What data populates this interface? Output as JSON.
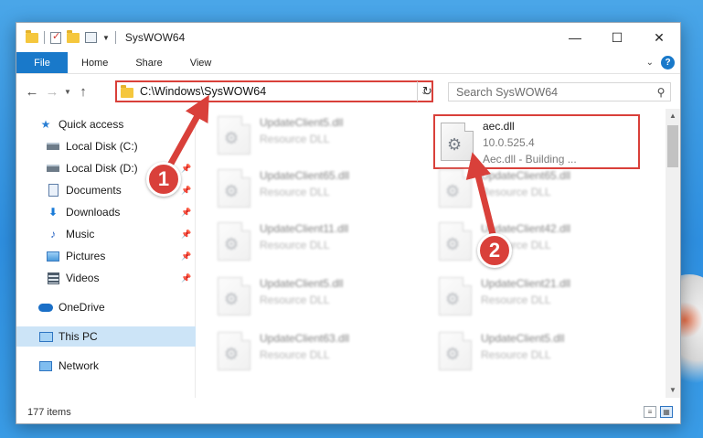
{
  "window": {
    "title": "SysWOW64",
    "controls": {
      "minimize": "—",
      "maximize": "☐",
      "close": "✕"
    }
  },
  "ribbon": {
    "tabs": [
      "File",
      "Home",
      "Share",
      "View"
    ],
    "help": "?"
  },
  "address": {
    "path": "C:\\Windows\\SysWOW64",
    "refresh": "↻"
  },
  "search": {
    "placeholder": "Search SysWOW64"
  },
  "sidebar": {
    "items": [
      {
        "label": "Quick access",
        "icon": "star-icon"
      },
      {
        "label": "Local Disk (C:)",
        "icon": "drive-icon"
      },
      {
        "label": "Local Disk (D:)",
        "icon": "drive-icon"
      },
      {
        "label": "Documents",
        "icon": "documents-icon"
      },
      {
        "label": "Downloads",
        "icon": "download-icon"
      },
      {
        "label": "Music",
        "icon": "music-icon"
      },
      {
        "label": "Pictures",
        "icon": "pictures-icon"
      },
      {
        "label": "Videos",
        "icon": "videos-icon"
      },
      {
        "label": "OneDrive",
        "icon": "cloud-icon"
      },
      {
        "label": "This PC",
        "icon": "computer-icon"
      },
      {
        "label": "Network",
        "icon": "network-icon"
      }
    ]
  },
  "files": {
    "col1": [
      {
        "name": "UpdateClient5.dll",
        "type": "Resource DLL"
      },
      {
        "name": "UpdateClient65.dll",
        "type": "Resource DLL"
      },
      {
        "name": "UpdateClient11.dll",
        "type": "Resource DLL"
      },
      {
        "name": "UpdateClient5.dll",
        "type": "Resource DLL"
      },
      {
        "name": "UpdateClient63.dll",
        "type": "Resource DLL"
      }
    ],
    "selected": {
      "name": "aec.dll",
      "version": "10.0.525.4",
      "description": "Aec.dll - Building ..."
    },
    "col2": [
      {
        "name": "UpdateClient65.dll",
        "type": "Resource DLL"
      },
      {
        "name": "UpdateClient42.dll",
        "type": "Resource DLL"
      },
      {
        "name": "UpdateClient21.dll",
        "type": "Resource DLL"
      },
      {
        "name": "UpdateClient5.dll",
        "type": "Resource DLL"
      }
    ]
  },
  "status": {
    "item_count": "177 items"
  },
  "annotations": {
    "step1": "1",
    "step2": "2",
    "color": "#d9403a"
  }
}
